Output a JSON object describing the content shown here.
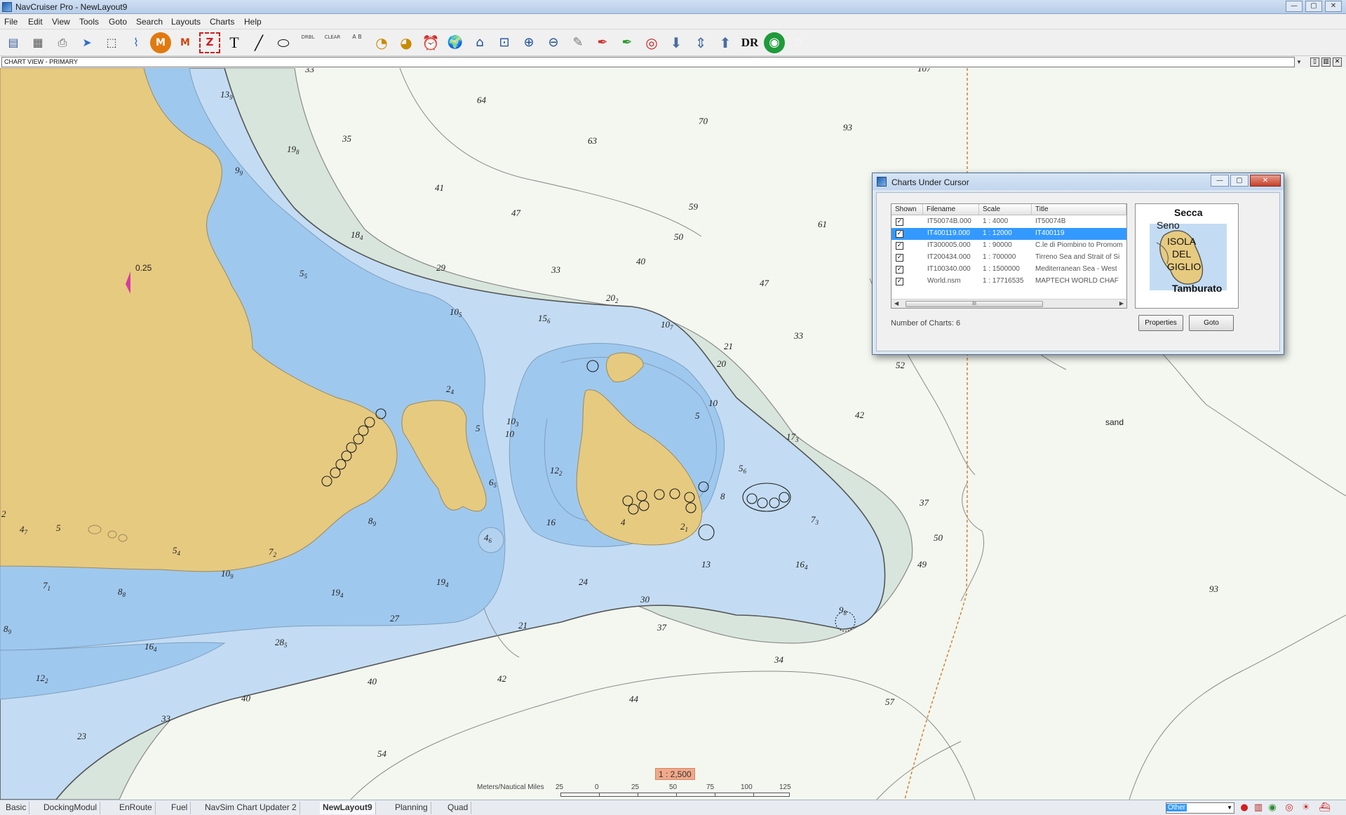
{
  "window": {
    "title": "NavCruiser Pro - NewLayout9",
    "minimize": "—",
    "maximize": "▢",
    "close": "✕"
  },
  "menu": [
    "File",
    "Edit",
    "View",
    "Tools",
    "Goto",
    "Search",
    "Layouts",
    "Charts",
    "Help"
  ],
  "toolbar": {
    "tool_icons": [
      "route-list-icon",
      "table-icon",
      "print-icon",
      "pointer-icon",
      "select-rect-icon",
      "route-plot-icon",
      "mark-m-icon",
      "mark-m2-icon",
      "mark-z-icon",
      "text-tool-icon",
      "line-tool-icon",
      "ellipse-tool-icon",
      "drbl-icon",
      "clear-drbl-icon",
      "ruler-ab-icon",
      "timer-icon",
      "stopwatch-icon",
      "alarm-icon",
      "world-icon",
      "home-icon",
      "zoom-area-icon",
      "zoom-in-icon",
      "zoom-out-icon",
      "feather-icon",
      "pen-icon",
      "pen-green-icon",
      "lifebuoy-icon",
      "arrow-down-icon",
      "split-icon",
      "arrow-up-icon",
      "dr-icon",
      "target-icon",
      "d-icon"
    ],
    "dr_label": "DR",
    "d_label": "D",
    "text_label": "T",
    "m_label": "M",
    "z_label": "Z",
    "drbl_label": "DRBL",
    "clear_label": "CLEAR",
    "ab_label": "A  B"
  },
  "view_bar": {
    "value": "CHART VIEW - PRIMARY"
  },
  "chart": {
    "current_marker_value": "0.25",
    "bottom_label": "sand",
    "soundings": [
      {
        "v": "33"
      },
      {
        "v": "13",
        "s": "9"
      },
      {
        "v": "64"
      },
      {
        "v": "70"
      },
      {
        "v": "93"
      },
      {
        "v": "35"
      },
      {
        "v": "63"
      },
      {
        "v": "19",
        "s": "8"
      },
      {
        "v": "9",
        "s": "9"
      },
      {
        "v": "41"
      },
      {
        "v": "59"
      },
      {
        "v": "47"
      },
      {
        "v": "61"
      },
      {
        "v": "50"
      },
      {
        "v": "18",
        "s": "4"
      },
      {
        "v": "40"
      },
      {
        "v": "29"
      },
      {
        "v": "33"
      },
      {
        "v": "5",
        "s": "5"
      },
      {
        "v": "47"
      },
      {
        "v": "20",
        "s": "2"
      },
      {
        "v": "10",
        "s": "5"
      },
      {
        "v": "15",
        "s": "6"
      },
      {
        "v": "10",
        "s": "7"
      },
      {
        "v": "21"
      },
      {
        "v": "33"
      },
      {
        "v": "20"
      },
      {
        "v": "52"
      },
      {
        "v": "2",
        "s": "4"
      },
      {
        "v": "10"
      },
      {
        "v": "5"
      },
      {
        "v": "10",
        "s": "3"
      },
      {
        "v": "10"
      },
      {
        "v": "5"
      },
      {
        "v": "42"
      },
      {
        "v": "17",
        "s": "3"
      },
      {
        "v": "12",
        "s": "2"
      },
      {
        "v": "5",
        "s": "6"
      },
      {
        "v": "6",
        "s": "5"
      },
      {
        "v": "8"
      },
      {
        "v": "37"
      },
      {
        "v": "2"
      },
      {
        "v": "4",
        "s": "7"
      },
      {
        "v": "5"
      },
      {
        "v": "8",
        "s": "9"
      },
      {
        "v": "16"
      },
      {
        "v": "4"
      },
      {
        "v": "2",
        "s": "1"
      },
      {
        "v": "7",
        "s": "3"
      },
      {
        "v": "4",
        "s": "6"
      },
      {
        "v": "50"
      },
      {
        "v": "5",
        "s": "4"
      },
      {
        "v": "7",
        "s": "2"
      },
      {
        "v": "49"
      },
      {
        "v": "10",
        "s": "9"
      },
      {
        "v": "13"
      },
      {
        "v": "16",
        "s": "4"
      },
      {
        "v": "7",
        "s": "1"
      },
      {
        "v": "8",
        "s": "8"
      },
      {
        "v": "19",
        "s": "4"
      },
      {
        "v": "19",
        "s": "4"
      },
      {
        "v": "24"
      },
      {
        "v": "93"
      },
      {
        "v": "30"
      },
      {
        "v": "9",
        "s": "8"
      },
      {
        "v": "27"
      },
      {
        "v": "21"
      },
      {
        "v": "37"
      },
      {
        "v": "8",
        "s": "9"
      },
      {
        "v": "16",
        "s": "4"
      },
      {
        "v": "28",
        "s": "5"
      },
      {
        "v": "34"
      },
      {
        "v": "12",
        "s": "2"
      },
      {
        "v": "40"
      },
      {
        "v": "42"
      },
      {
        "v": "40"
      },
      {
        "v": "44"
      },
      {
        "v": "57"
      },
      {
        "v": "33"
      },
      {
        "v": "23"
      },
      {
        "v": "54"
      },
      {
        "v": "107"
      }
    ]
  },
  "scale": {
    "ratio": "1 : 2,500",
    "units": "Meters/Nautical Miles",
    "ticks": [
      "25",
      "0",
      "25",
      "50",
      "75",
      "100",
      "125"
    ]
  },
  "dialog": {
    "title": "Charts Under Cursor",
    "columns": [
      "Shown",
      "Filename",
      "Scale",
      "Title"
    ],
    "rows": [
      {
        "shown": true,
        "filename": "IT50074B.000",
        "scale": "1 : 4000",
        "title": "IT50074B",
        "selected": false
      },
      {
        "shown": true,
        "filename": "IT400119.000",
        "scale": "1 : 12000",
        "title": "IT400119",
        "selected": true
      },
      {
        "shown": true,
        "filename": "IT300005.000",
        "scale": "1 : 90000",
        "title": "C.le di Piombino to Promom",
        "selected": false
      },
      {
        "shown": true,
        "filename": "IT200434.000",
        "scale": "1 : 700000",
        "title": "Tirreno Sea and Strait of Si",
        "selected": false
      },
      {
        "shown": true,
        "filename": "IT100340.000",
        "scale": "1 : 1500000",
        "title": "Mediterranean Sea - West",
        "selected": false
      },
      {
        "shown": true,
        "filename": "World.nsm",
        "scale": "1 : 17716535",
        "title": "MAPTECH WORLD CHAF",
        "selected": false
      }
    ],
    "scroll_grip": "III",
    "preview_labels": [
      "Secca",
      "Seno",
      "ISOLA",
      "DEL",
      "GIGLIO",
      "Tamburato"
    ],
    "count_label": "Number of Charts:",
    "count_value": "6",
    "properties_button": "Properties",
    "goto_button": "Goto"
  },
  "status_tabs": [
    {
      "label": "Basic",
      "active": false
    },
    {
      "label": "DockingModul",
      "active": false
    },
    {
      "label": "EnRoute",
      "active": false
    },
    {
      "label": "Fuel",
      "active": false
    },
    {
      "label": "NavSim Chart Updater 2",
      "active": false
    },
    {
      "label": "NewLayout9",
      "active": true
    },
    {
      "label": "Planning",
      "active": false
    },
    {
      "label": "Quad",
      "active": false
    }
  ],
  "layer_select": {
    "value": "Other"
  },
  "status_icons": [
    "red-dot-icon",
    "signal-icon",
    "radio-icon",
    "target-icon",
    "sun-icon",
    "ship-icon"
  ],
  "colors": {
    "land": "#e6ca80",
    "shallow": "#9fc8ee",
    "medium": "#c3dcf3",
    "deep": "#d8e5dc",
    "open": "#f3f7ef",
    "selection": "#3399ff",
    "scale_badge": "#f0a98a"
  }
}
